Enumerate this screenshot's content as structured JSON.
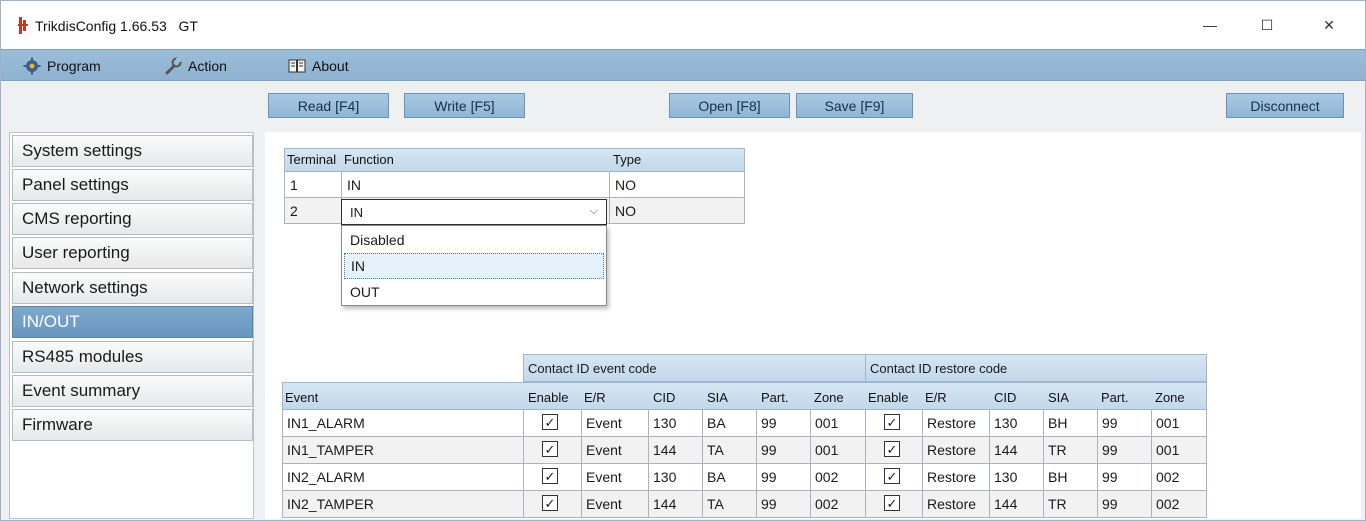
{
  "window": {
    "title": "TrikdisConfig 1.66.53",
    "title_suffix": "GT",
    "controls": {
      "minimize": "—",
      "maximize": "☐",
      "close": "✕"
    }
  },
  "menu": {
    "program": "Program",
    "action": "Action",
    "about": "About"
  },
  "toolbar": {
    "read": "Read [F4]",
    "write": "Write [F5]",
    "open": "Open [F8]",
    "save": "Save [F9]",
    "disconnect": "Disconnect"
  },
  "sidebar": {
    "items": [
      {
        "label": "System settings"
      },
      {
        "label": "Panel settings"
      },
      {
        "label": "CMS reporting"
      },
      {
        "label": "User reporting"
      },
      {
        "label": "Network settings"
      },
      {
        "label": "IN/OUT",
        "active": true
      },
      {
        "label": "RS485 modules"
      },
      {
        "label": "Event summary"
      },
      {
        "label": "Firmware"
      }
    ]
  },
  "terminal_table": {
    "headers": {
      "terminal": "Terminal",
      "function": "Function",
      "type": "Type"
    },
    "rows": [
      {
        "terminal": "1",
        "function": "IN",
        "type": "NO"
      },
      {
        "terminal": "2",
        "function": "IN",
        "type": "NO"
      }
    ],
    "dropdown": {
      "options": [
        "Disabled",
        "IN",
        "OUT"
      ],
      "selected": "IN"
    }
  },
  "event_table": {
    "groups": {
      "event_code": "Contact ID event code",
      "restore_code": "Contact ID restore code"
    },
    "headers": {
      "event": "Event",
      "enable": "Enable",
      "er": "E/R",
      "cid": "CID",
      "sia": "SIA",
      "part": "Part.",
      "zone": "Zone",
      "r_enable": "Enable",
      "r_er": "E/R",
      "r_cid": "CID",
      "r_sia": "SIA",
      "r_part": "Part.",
      "r_zone": "Zone"
    },
    "rows": [
      {
        "event": "IN1_ALARM",
        "enable": true,
        "er": "Event",
        "cid": "130",
        "sia": "BA",
        "part": "99",
        "zone": "001",
        "r_enable": true,
        "r_er": "Restore",
        "r_cid": "130",
        "r_sia": "BH",
        "r_part": "99",
        "r_zone": "001"
      },
      {
        "event": "IN1_TAMPER",
        "enable": true,
        "er": "Event",
        "cid": "144",
        "sia": "TA",
        "part": "99",
        "zone": "001",
        "r_enable": true,
        "r_er": "Restore",
        "r_cid": "144",
        "r_sia": "TR",
        "r_part": "99",
        "r_zone": "001"
      },
      {
        "event": "IN2_ALARM",
        "enable": true,
        "er": "Event",
        "cid": "130",
        "sia": "BA",
        "part": "99",
        "zone": "002",
        "r_enable": true,
        "r_er": "Restore",
        "r_cid": "130",
        "r_sia": "BH",
        "r_part": "99",
        "r_zone": "002"
      },
      {
        "event": "IN2_TAMPER",
        "enable": true,
        "er": "Event",
        "cid": "144",
        "sia": "TA",
        "part": "99",
        "zone": "002",
        "r_enable": true,
        "r_er": "Restore",
        "r_cid": "144",
        "r_sia": "TR",
        "r_part": "99",
        "r_zone": "002"
      }
    ]
  },
  "colors": {
    "accent": "#7ea8cc",
    "menu_bar": "#9dbdd8",
    "header_bg": "#c9dcec"
  },
  "icons": {
    "app": "trikdis-app-icon",
    "program": "gear-icon",
    "action": "wrench-icon",
    "about": "book-icon"
  }
}
